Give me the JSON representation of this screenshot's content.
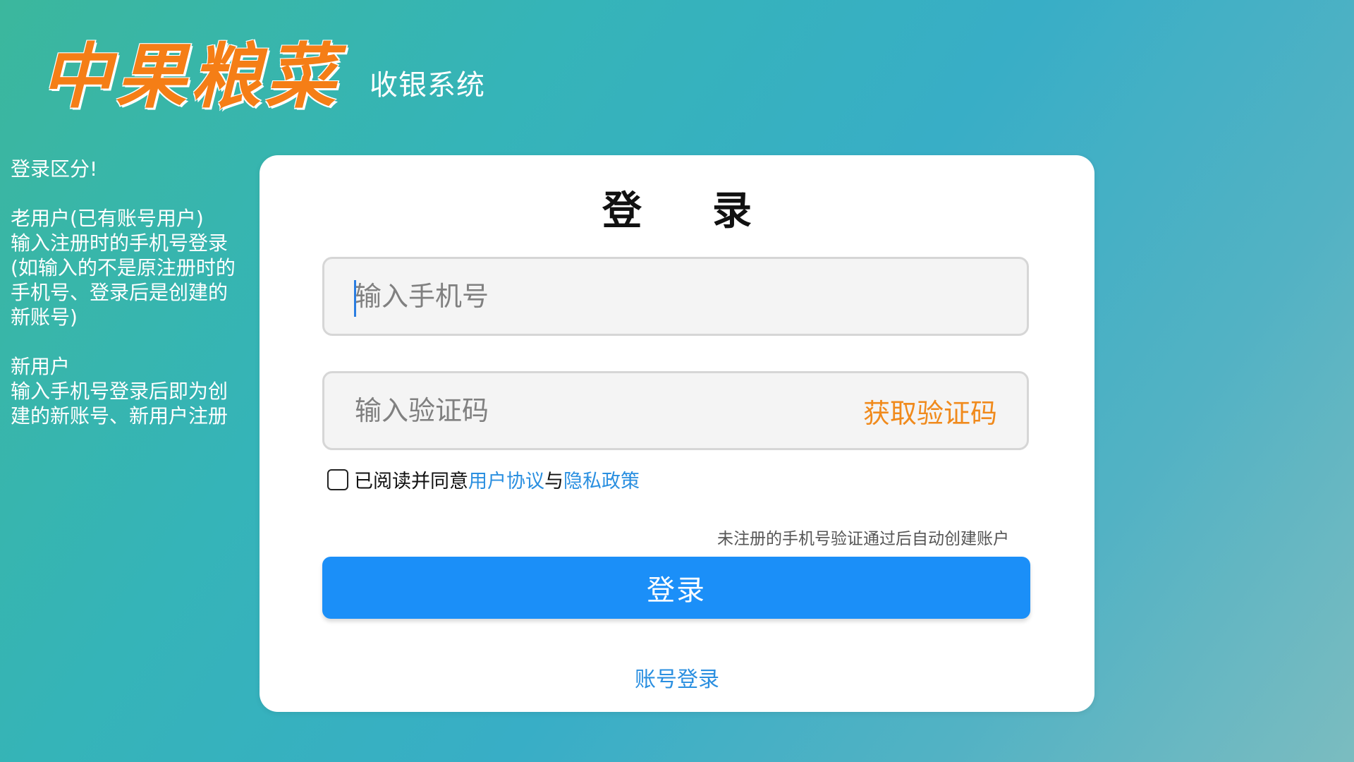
{
  "brand": {
    "logo_text": "中果粮菜",
    "subtitle": "收银系统"
  },
  "notice": {
    "title": "登录区分!",
    "old_user": "老用户(已有账号用户)\n输入注册时的手机号登录\n(如输入的不是原注册时的\n手机号、登录后是创建的\n新账号)",
    "new_user": "新用户\n输入手机号登录后即为创\n建的新账号、新用户注册"
  },
  "login": {
    "title": "登录",
    "phone_placeholder": "输入手机号",
    "phone_value": "",
    "code_placeholder": "输入验证码",
    "code_value": "",
    "get_code_label": "获取验证码",
    "agreement": {
      "checked": false,
      "prefix": "已阅读并同意",
      "user_agreement": "用户协议",
      "conjunction": "与",
      "privacy_policy": "隐私政策"
    },
    "hint": "未注册的手机号验证通过后自动创建账户",
    "submit_label": "登录",
    "account_login_label": "账号登录"
  },
  "colors": {
    "brand_orange": "#f57e16",
    "primary_blue": "#1b8ff8",
    "link_blue": "#2a8fe0",
    "get_code_orange": "#f08a1c"
  }
}
